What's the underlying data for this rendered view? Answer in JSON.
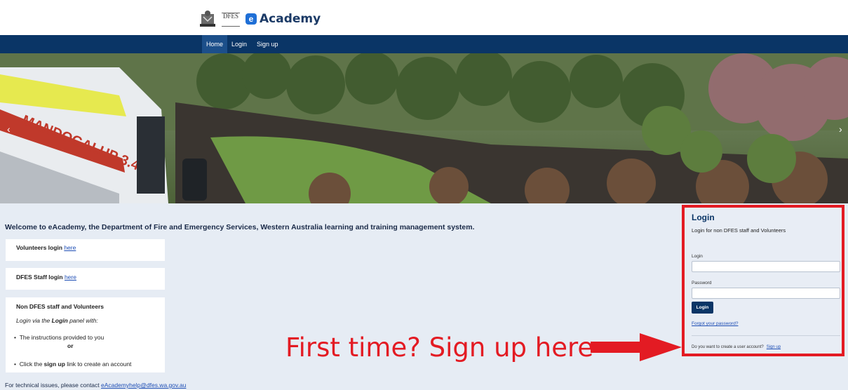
{
  "header": {
    "logo_dfes_text": "DFES",
    "logo_e": "e",
    "logo_text": "Academy"
  },
  "nav": {
    "home": "Home",
    "login": "Login",
    "signup": "Sign up"
  },
  "hero": {
    "truck_text": "MANDOGALUP 3.4U",
    "prev_icon": "chevron-left-icon",
    "next_icon": "chevron-right-icon"
  },
  "welcome": "Welcome to eAcademy, the Department of Fire and Emergency Services, Western Australia learning and training management system.",
  "cards": {
    "volunteers_prefix": "Volunteers login ",
    "volunteers_link": "here",
    "staff_prefix": "DFES Staff login ",
    "staff_link": "here",
    "non_title": "Non DFES staff and Volunteers",
    "via_prefix": "Login via the ",
    "via_bold": "Login",
    "via_suffix": " panel with:",
    "bullet1": "The instructions provided to you",
    "or": "or",
    "bullet2_prefix": "Click the ",
    "bullet2_bold": "sign up",
    "bullet2_suffix": " link to create an account"
  },
  "footer": {
    "prefix": "For technical issues, please contact ",
    "email": "eAcademyhelp@dfes.wa.gov.au"
  },
  "login_panel": {
    "title": "Login",
    "subtitle": "Login for non DFES staff and Volunteers",
    "login_label": "Login",
    "login_value": "",
    "password_label": "Password",
    "password_value": "",
    "button": "Login",
    "forgot": "Forgot your password?",
    "create_prompt": "Do you want to create a user account?",
    "signup_link": "Sign up"
  },
  "annotation": {
    "text": "First time? Sign up here",
    "color": "#e31b23"
  },
  "colors": {
    "navbar": "#0a3566",
    "accent": "#1f6fd6",
    "highlight": "#e31b23"
  }
}
